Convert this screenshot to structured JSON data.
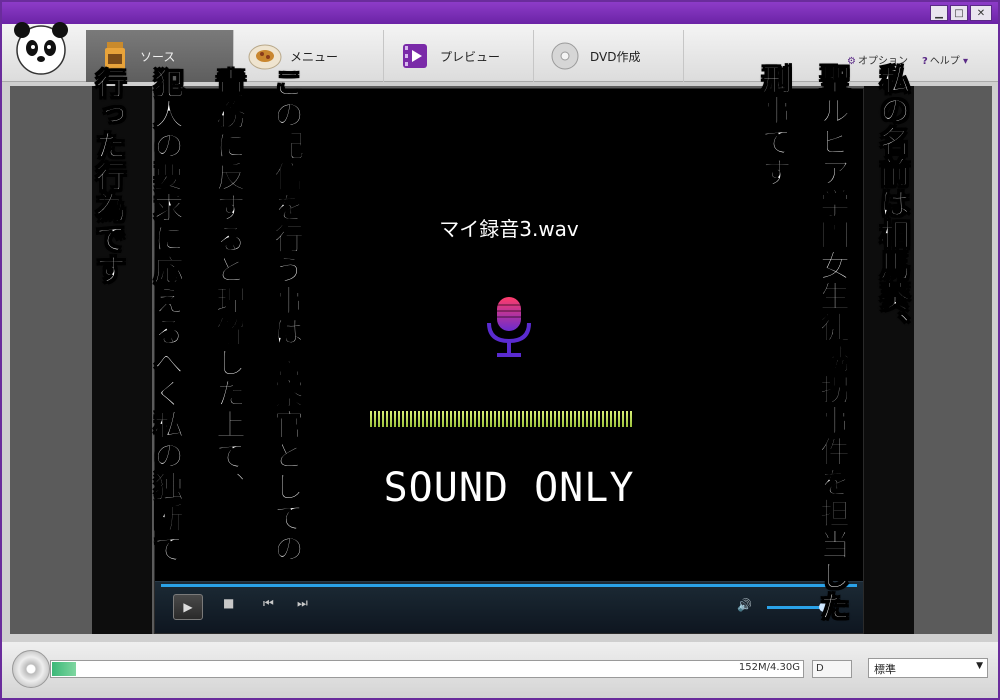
{
  "window": {
    "controls": {
      "minimize": "▁",
      "maximize": "□",
      "close": "✕"
    }
  },
  "toolbar": {
    "tabs": [
      {
        "label": "ソース",
        "icon": "source-icon"
      },
      {
        "label": "メニュー",
        "icon": "menu-icon"
      },
      {
        "label": "プレビュー",
        "icon": "preview-icon"
      },
      {
        "label": "DVD作成",
        "icon": "dvd-icon"
      }
    ],
    "option_label": "オプション",
    "help_label": "ヘルプ"
  },
  "player": {
    "filename": "マイ録音3.wav",
    "sound_only": "SOUND ONLY"
  },
  "status": {
    "capacity": "152M/4.30G",
    "dvd_label": "D",
    "quality": "標準"
  },
  "captions": [
    "私の名前は相馬葵、",
    "聖ルビア学園女生徒誘拐事件を担当した",
    "刑事です",
    "この配信を行う事は警察官としての",
    "責務に反すると理解した上で、",
    "犯人の要求に応えるべく私の独断で",
    "行った行為です"
  ],
  "colors": {
    "accent": "#6b23a6",
    "seek": "#2aa2e8",
    "level": "#c8e060"
  }
}
